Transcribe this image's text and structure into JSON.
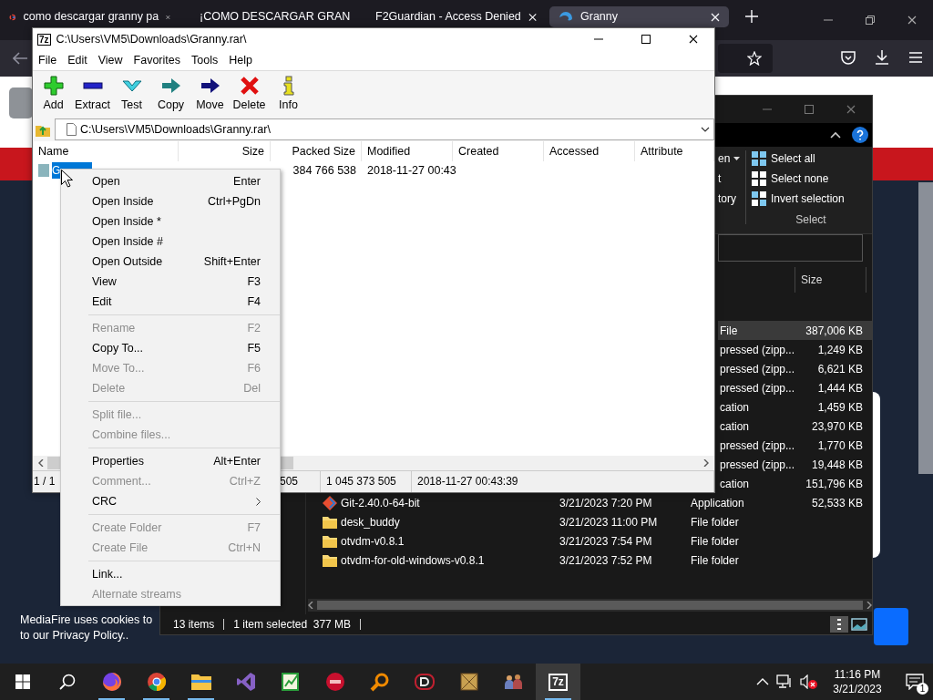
{
  "browser": {
    "tabs": [
      {
        "label": "como descargar granny pa",
        "selected": false
      },
      {
        "label": "¡COMO DESCARGAR GRAN",
        "selected": false
      },
      {
        "label": "F2Guardian - Access Denied",
        "selected": false
      },
      {
        "label": "Granny",
        "selected": true
      }
    ],
    "cookie_banner": {
      "lines": [
        "MediaFire uses cookies to",
        "to our Privacy Policy.."
      ]
    }
  },
  "explorer": {
    "ribbon_fragments": [
      {
        "label": "en",
        "dropdown": true
      },
      {
        "label": "t",
        "dropdown": false
      },
      {
        "label": "tory",
        "dropdown": false
      }
    ],
    "select_group": {
      "label": "Select",
      "items": [
        {
          "label": "Select all"
        },
        {
          "label": "Select none"
        },
        {
          "label": "Invert selection"
        }
      ]
    },
    "columns": [
      "Size"
    ],
    "rows": [
      {
        "kind": "partial",
        "type": "File",
        "size": "387,006 KB",
        "selected": true
      },
      {
        "kind": "partial",
        "type": "pressed (zipp...",
        "size": "1,249 KB",
        "selected": false
      },
      {
        "kind": "partial",
        "type": "pressed (zipp...",
        "size": "6,621 KB",
        "selected": false
      },
      {
        "kind": "partial",
        "type": "pressed (zipp...",
        "size": "1,444 KB",
        "selected": false
      },
      {
        "kind": "partial",
        "type": "cation",
        "size": "1,459 KB",
        "selected": false
      },
      {
        "kind": "partial",
        "type": "cation",
        "size": "23,970 KB",
        "selected": false
      },
      {
        "kind": "partial",
        "type": "pressed (zipp...",
        "size": "1,770 KB",
        "selected": false
      },
      {
        "kind": "partial",
        "type": "pressed (zipp...",
        "size": "19,448 KB",
        "selected": false
      },
      {
        "kind": "partial",
        "type": "cation",
        "size": "151,796 KB",
        "selected": false
      },
      {
        "kind": "app",
        "name": "Git-2.40.0-64-bit",
        "date": "3/21/2023 7:20 PM",
        "type": "Application",
        "size": "52,533 KB",
        "selected": false
      },
      {
        "kind": "folder",
        "name": "desk_buddy",
        "date": "3/21/2023 11:00 PM",
        "type": "File folder",
        "selected": false
      },
      {
        "kind": "folder",
        "name": "otvdm-v0.8.1",
        "date": "3/21/2023 7:54 PM",
        "type": "File folder",
        "selected": false
      },
      {
        "kind": "folder",
        "name": "otvdm-for-old-windows-v0.8.1",
        "date": "3/21/2023 7:52 PM",
        "type": "File folder",
        "selected": false
      }
    ],
    "status": [
      "13 items",
      "1 item selected  377 MB"
    ]
  },
  "archive": {
    "logo": "7z",
    "title": "C:\\Users\\VM5\\Downloads\\Granny.rar\\",
    "menu": [
      "File",
      "Edit",
      "View",
      "Favorites",
      "Tools",
      "Help"
    ],
    "toolbar": [
      "Add",
      "Extract",
      "Test",
      "Copy",
      "Move",
      "Delete",
      "Info"
    ],
    "path": "C:\\Users\\VM5\\Downloads\\Granny.rar\\",
    "columns": [
      "Name",
      "Size",
      "Packed Size",
      "Modified",
      "Created",
      "Accessed",
      "Attribute"
    ],
    "rows": [
      {
        "name": "G",
        "packed_size": "384 766 538",
        "modified": "2018-11-27 00:43",
        "selected": true
      }
    ],
    "status": [
      "1 / 1",
      "505",
      "1 045 373 505",
      "2018-11-27 00:43:39"
    ]
  },
  "context_menu": {
    "items": [
      {
        "kind": "item",
        "label": "Open",
        "shortcut": "Enter",
        "disabled": false
      },
      {
        "kind": "item",
        "label": "Open Inside",
        "shortcut": "Ctrl+PgDn",
        "disabled": false
      },
      {
        "kind": "item",
        "label": "Open Inside *",
        "disabled": false
      },
      {
        "kind": "item",
        "label": "Open Inside #",
        "disabled": false
      },
      {
        "kind": "item",
        "label": "Open Outside",
        "shortcut": "Shift+Enter",
        "disabled": false
      },
      {
        "kind": "item",
        "label": "View",
        "shortcut": "F3",
        "disabled": false
      },
      {
        "kind": "item",
        "label": "Edit",
        "shortcut": "F4",
        "disabled": false
      },
      {
        "kind": "separator"
      },
      {
        "kind": "item",
        "label": "Rename",
        "shortcut": "F2",
        "disabled": true
      },
      {
        "kind": "item",
        "label": "Copy To...",
        "shortcut": "F5",
        "disabled": false
      },
      {
        "kind": "item",
        "label": "Move To...",
        "shortcut": "F6",
        "disabled": true
      },
      {
        "kind": "item",
        "label": "Delete",
        "shortcut": "Del",
        "disabled": true
      },
      {
        "kind": "separator"
      },
      {
        "kind": "item",
        "label": "Split file...",
        "disabled": true
      },
      {
        "kind": "item",
        "label": "Combine files...",
        "disabled": true
      },
      {
        "kind": "separator"
      },
      {
        "kind": "item",
        "label": "Properties",
        "shortcut": "Alt+Enter",
        "disabled": false
      },
      {
        "kind": "item",
        "label": "Comment...",
        "shortcut": "Ctrl+Z",
        "disabled": true
      },
      {
        "kind": "submenu",
        "label": "CRC",
        "disabled": false
      },
      {
        "kind": "separator"
      },
      {
        "kind": "item",
        "label": "Create Folder",
        "shortcut": "F7",
        "disabled": true
      },
      {
        "kind": "item",
        "label": "Create File",
        "shortcut": "Ctrl+N",
        "disabled": true
      },
      {
        "kind": "separator"
      },
      {
        "kind": "item",
        "label": "Link...",
        "disabled": false
      },
      {
        "kind": "item",
        "label": "Alternate streams",
        "disabled": true
      }
    ]
  },
  "taskbar": {
    "apps": [
      {
        "kind": "firefox",
        "running": true,
        "active": false
      },
      {
        "kind": "chrome",
        "running": true,
        "active": false
      },
      {
        "kind": "folder",
        "running": true,
        "active": false
      },
      {
        "kind": "vs",
        "running": false,
        "active": false
      },
      {
        "kind": "notepad",
        "running": false,
        "active": false
      },
      {
        "kind": "devcpp",
        "running": false,
        "active": false
      },
      {
        "kind": "magnifier",
        "running": false,
        "active": false
      },
      {
        "kind": "disc",
        "running": false,
        "active": false
      },
      {
        "kind": "dosbox",
        "running": false,
        "active": false
      },
      {
        "kind": "people",
        "running": false,
        "active": false
      },
      {
        "kind": "logo",
        "label": "7z",
        "running": true,
        "active": true
      }
    ],
    "time": "11:16 PM",
    "date": "3/21/2023",
    "notification_count": "1"
  }
}
